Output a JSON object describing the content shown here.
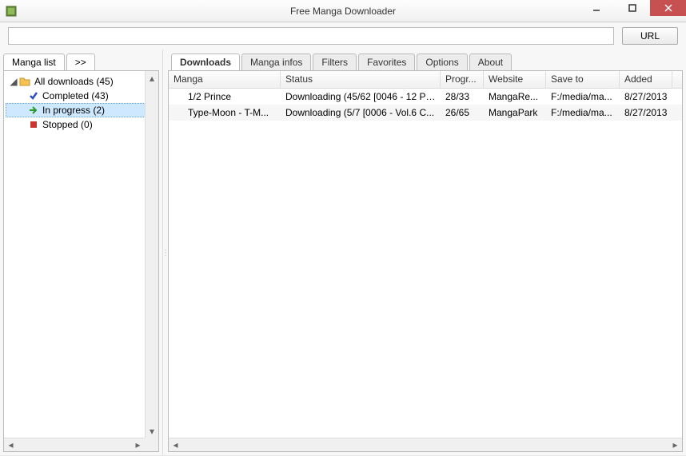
{
  "window": {
    "title": "Free Manga Downloader"
  },
  "urlbar": {
    "value": "",
    "button": "URL"
  },
  "sidebar": {
    "tabs": {
      "main": "Manga list",
      "more": ">>"
    },
    "root": {
      "label": "All downloads (45)"
    },
    "items": [
      {
        "name": "completed",
        "label": "Completed (43)",
        "icon": "check",
        "color": "#2b4fbf",
        "selected": false
      },
      {
        "name": "in-progress",
        "label": "In progress (2)",
        "icon": "arrow",
        "color": "#2a9b2a",
        "selected": true
      },
      {
        "name": "stopped",
        "label": "Stopped (0)",
        "icon": "square",
        "color": "#c33",
        "selected": false
      }
    ]
  },
  "main": {
    "tabs": [
      {
        "name": "downloads",
        "label": "Downloads",
        "active": true
      },
      {
        "name": "manga-infos",
        "label": "Manga infos",
        "active": false
      },
      {
        "name": "filters",
        "label": "Filters",
        "active": false
      },
      {
        "name": "favorites",
        "label": "Favorites",
        "active": false
      },
      {
        "name": "options",
        "label": "Options",
        "active": false
      },
      {
        "name": "about",
        "label": "About",
        "active": false
      }
    ],
    "columns": {
      "manga": "Manga",
      "status": "Status",
      "progress": "Progr...",
      "website": "Website",
      "saveto": "Save to",
      "added": "Added"
    },
    "rows": [
      {
        "manga": "1/2 Prince",
        "status": "Downloading (45/62 [0046 - 12 Pri...",
        "progress": "28/33",
        "website": "MangaRe...",
        "saveto": "F:/media/ma...",
        "added": "8/27/2013"
      },
      {
        "manga": "Type-Moon - T-M...",
        "status": "Downloading (5/7 [0006 - Vol.6 C...",
        "progress": "26/65",
        "website": "MangaPark",
        "saveto": "F:/media/ma...",
        "added": "8/27/2013"
      }
    ]
  }
}
